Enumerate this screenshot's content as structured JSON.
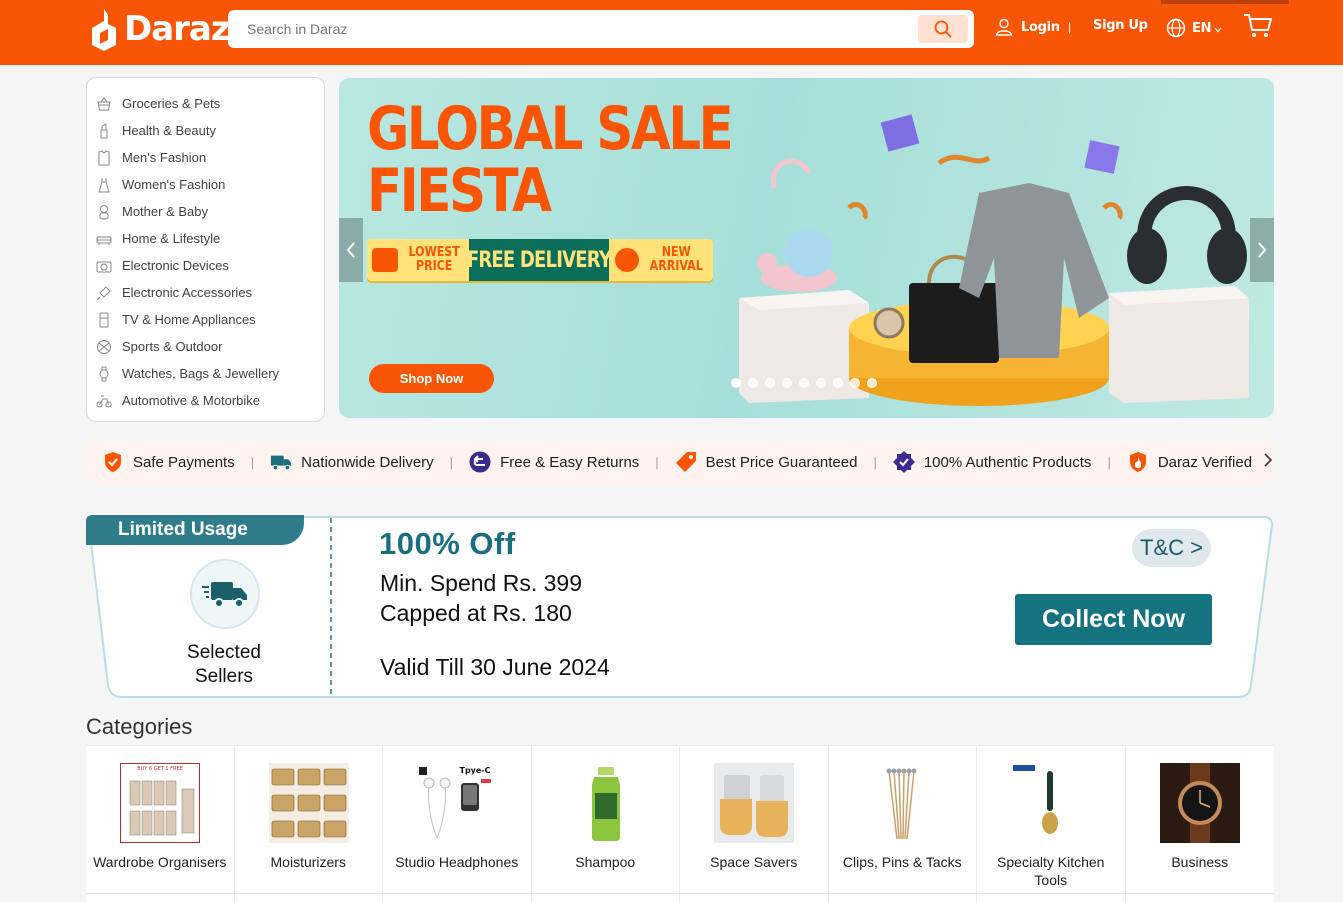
{
  "header": {
    "logo_text": "Daraz",
    "search_placeholder": "Search in Daraz",
    "login": "Login",
    "separator": "|",
    "signup": "Sign Up",
    "language": "EN",
    "brand_color": "#f85606"
  },
  "sidebar": {
    "items": [
      {
        "label": "Groceries & Pets",
        "icon": "basket-icon"
      },
      {
        "label": "Health & Beauty",
        "icon": "lipstick-icon"
      },
      {
        "label": "Men's Fashion",
        "icon": "shirt-icon"
      },
      {
        "label": "Women's Fashion",
        "icon": "dress-icon"
      },
      {
        "label": "Mother & Baby",
        "icon": "baby-icon"
      },
      {
        "label": "Home & Lifestyle",
        "icon": "sofa-icon"
      },
      {
        "label": "Electronic Devices",
        "icon": "camera-icon"
      },
      {
        "label": "Electronic Accessories",
        "icon": "plug-icon"
      },
      {
        "label": "TV & Home Appliances",
        "icon": "fridge-icon"
      },
      {
        "label": "Sports & Outdoor",
        "icon": "ball-icon"
      },
      {
        "label": "Watches, Bags & Jewellery",
        "icon": "watch-icon"
      },
      {
        "label": "Automotive & Motorbike",
        "icon": "motorbike-icon"
      }
    ]
  },
  "banner": {
    "title_line1": "GLOBAL SALE",
    "title_line2": "FIESTA",
    "ribbon_left_1": "LOWEST",
    "ribbon_left_2": "PRICE",
    "ribbon_mid": "FREE DELIVERY",
    "ribbon_right_1": "NEW",
    "ribbon_right_2": "ARRIVAL",
    "shop_now": "Shop Now",
    "slide_count": 9,
    "active_slide": 1
  },
  "value_props": [
    {
      "label": "Safe Payments",
      "icon": "shield-check-icon"
    },
    {
      "label": "Nationwide Delivery",
      "icon": "delivery-truck-icon"
    },
    {
      "label": "Free & Easy Returns",
      "icon": "return-arrow-icon"
    },
    {
      "label": "Best Price Guaranteed",
      "icon": "price-tag-icon"
    },
    {
      "label": "100% Authentic Products",
      "icon": "verified-badge-icon"
    },
    {
      "label": "Daraz Verified",
      "icon": "daraz-shield-icon"
    }
  ],
  "voucher": {
    "badge": "Limited Usage",
    "sellers_line1": "Selected",
    "sellers_line2": "Sellers",
    "offer": "100% Off",
    "min_spend": "Min. Spend Rs. 399",
    "capped": "Capped at Rs. 180",
    "valid": "Valid Till 30 June 2024",
    "tc": "T&C >",
    "collect": "Collect Now"
  },
  "categories": {
    "heading": "Categories",
    "items": [
      {
        "label": "Wardrobe Organisers"
      },
      {
        "label": "Moisturizers"
      },
      {
        "label": "Studio Headphones"
      },
      {
        "label": "Shampoo"
      },
      {
        "label": "Space Savers"
      },
      {
        "label": "Clips, Pins & Tacks"
      },
      {
        "label": "Specialty Kitchen Tools"
      },
      {
        "label": "Business"
      }
    ]
  }
}
